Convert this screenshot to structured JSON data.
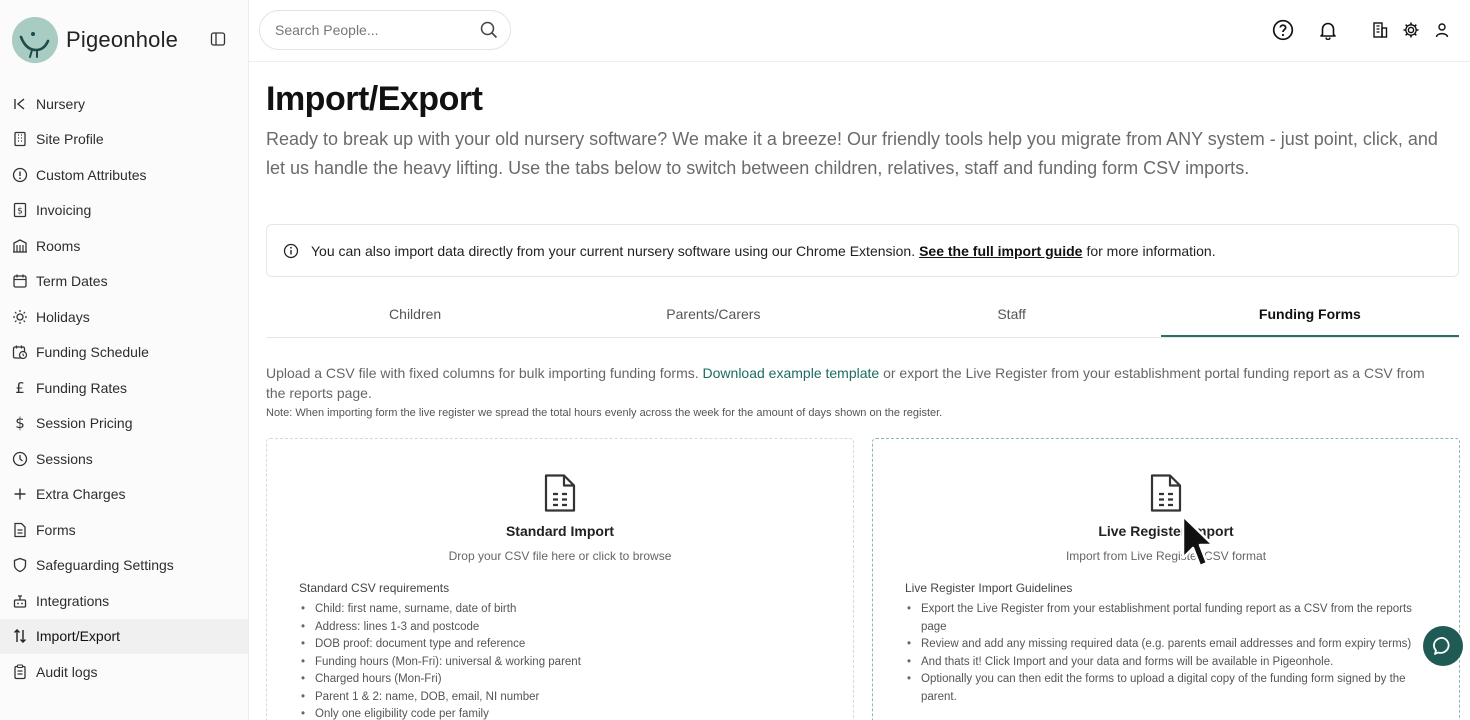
{
  "brand": {
    "name": "Pigeonhole"
  },
  "sidebar": {
    "items": [
      {
        "label": "Nursery",
        "icon": "arrow-left-to-line-icon"
      },
      {
        "label": "Site Profile",
        "icon": "building-icon"
      },
      {
        "label": "Custom Attributes",
        "icon": "info-circle-icon"
      },
      {
        "label": "Invoicing",
        "icon": "receipt-icon"
      },
      {
        "label": "Rooms",
        "icon": "rooms-icon"
      },
      {
        "label": "Term Dates",
        "icon": "calendar-icon"
      },
      {
        "label": "Holidays",
        "icon": "sun-icon"
      },
      {
        "label": "Funding Schedule",
        "icon": "calendar-clock-icon"
      },
      {
        "label": "Funding Rates",
        "icon": "pound-icon"
      },
      {
        "label": "Session Pricing",
        "icon": "dollar-icon"
      },
      {
        "label": "Sessions",
        "icon": "clock-icon"
      },
      {
        "label": "Extra Charges",
        "icon": "plus-icon"
      },
      {
        "label": "Forms",
        "icon": "document-icon"
      },
      {
        "label": "Safeguarding Settings",
        "icon": "shield-icon"
      },
      {
        "label": "Integrations",
        "icon": "plug-icon"
      },
      {
        "label": "Import/Export",
        "icon": "arrows-up-down-icon"
      },
      {
        "label": "Audit logs",
        "icon": "clipboard-icon"
      }
    ],
    "active": "Import/Export"
  },
  "search": {
    "placeholder": "Search People..."
  },
  "page": {
    "title": "Import/Export",
    "intro": "Ready to break up with your old nursery software? We make it a breeze! Our friendly tools help you migrate from ANY system - just point, click, and let us handle the heavy lifting. Use the tabs below to switch between children, relatives, staff and funding form CSV imports.",
    "notice_before": "You can also import data directly from your current nursery software using our Chrome Extension.",
    "notice_link": "See the full import guide",
    "notice_after": "for more information."
  },
  "tabs": [
    {
      "label": "Children"
    },
    {
      "label": "Parents/Carers"
    },
    {
      "label": "Staff"
    },
    {
      "label": "Funding Forms"
    }
  ],
  "active_tab": "Funding Forms",
  "funding": {
    "desc_before": "Upload a CSV file with fixed columns for bulk importing funding forms.",
    "desc_link": "Download example template",
    "desc_after": "or export the Live Register from your establishment portal funding report as a CSV from the reports page.",
    "note": "Note: When importing form the live register we spread the total hours evenly across the week for the amount of days shown on the register."
  },
  "cards": {
    "standard": {
      "title": "Standard Import",
      "subtitle": "Drop your CSV file here or click to browse",
      "req_heading": "Standard CSV requirements",
      "items": [
        "Child: first name, surname, date of birth",
        "Address: lines 1-3 and postcode",
        "DOB proof: document type and reference",
        "Funding hours (Mon-Fri): universal & working parent",
        "Charged hours (Mon-Fri)",
        "Parent 1 & 2: name, DOB, email, NI number",
        "Only one eligibility code per family"
      ]
    },
    "live": {
      "title": "Live Register Import",
      "subtitle": "Import from Live Register CSV format",
      "req_heading": "Live Register Import Guidelines",
      "items": [
        "Export the Live Register from your establishment portal funding report as a CSV from the reports page",
        "Review and add any missing required data (e.g. parents email addresses and form expiry terms)",
        "And thats it! Click Import and your data and forms will be available in Pigeonhole.",
        "Optionally you can then edit the forms to upload a digital copy of the funding form signed by the parent."
      ]
    }
  },
  "colors": {
    "accent": "#2e6e66",
    "link": "#1e6b61",
    "chat": "#1f5a55"
  }
}
